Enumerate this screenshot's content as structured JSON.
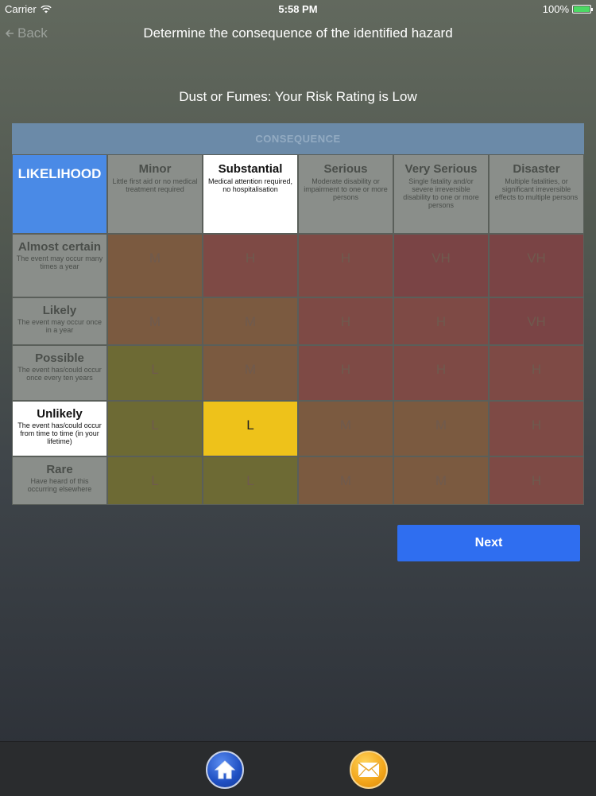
{
  "status_bar": {
    "carrier": "Carrier",
    "time": "5:58 PM",
    "battery": "100%"
  },
  "nav": {
    "back_label": "Back",
    "title": "Determine the consequence of the identified hazard"
  },
  "risk_heading": "Dust or Fumes: Your Risk Rating is Low",
  "matrix": {
    "consequence_label": "CONSEQUENCE",
    "likelihood_label": "LIKELIHOOD",
    "columns": [
      {
        "title": "Minor",
        "desc": "Little first aid or no medical treatment required"
      },
      {
        "title": "Substantial",
        "desc": "Medical attention required, no hospitalisation"
      },
      {
        "title": "Serious",
        "desc": "Moderate disability or impairment to one or more persons"
      },
      {
        "title": "Very Serious",
        "desc": "Single fatality and/or severe irreversible disability to one or more persons"
      },
      {
        "title": "Disaster",
        "desc": "Multiple fatalities, or significant irreversible effects to multiple persons"
      }
    ],
    "rows": [
      {
        "title": "Almost certain",
        "desc": "The event may occur many times a year",
        "ratings": [
          "M",
          "H",
          "H",
          "VH",
          "VH"
        ]
      },
      {
        "title": "Likely",
        "desc": "The event may occur once in a year",
        "ratings": [
          "M",
          "M",
          "H",
          "H",
          "VH"
        ]
      },
      {
        "title": "Possible",
        "desc": "The event has/could occur once every ten years",
        "ratings": [
          "L",
          "M",
          "H",
          "H",
          "H"
        ]
      },
      {
        "title": "Unlikely",
        "desc": "The event has/could occur from time to time (in your lifetime)",
        "ratings": [
          "L",
          "L",
          "M",
          "M",
          "H"
        ]
      },
      {
        "title": "Rare",
        "desc": "Have heard of this occurring elsewhere",
        "ratings": [
          "L",
          "L",
          "M",
          "M",
          "H"
        ]
      }
    ],
    "selected": {
      "row": 3,
      "col": 1
    },
    "colors": {
      "L": "#6d6a34",
      "M": "#7b5a40",
      "H": "#7e4a45",
      "VH": "#7a4445",
      "selected": "#eec21a"
    }
  },
  "next_label": "Next",
  "tab_bar": {
    "home_icon": "home-icon",
    "mail_icon": "mail-icon"
  }
}
